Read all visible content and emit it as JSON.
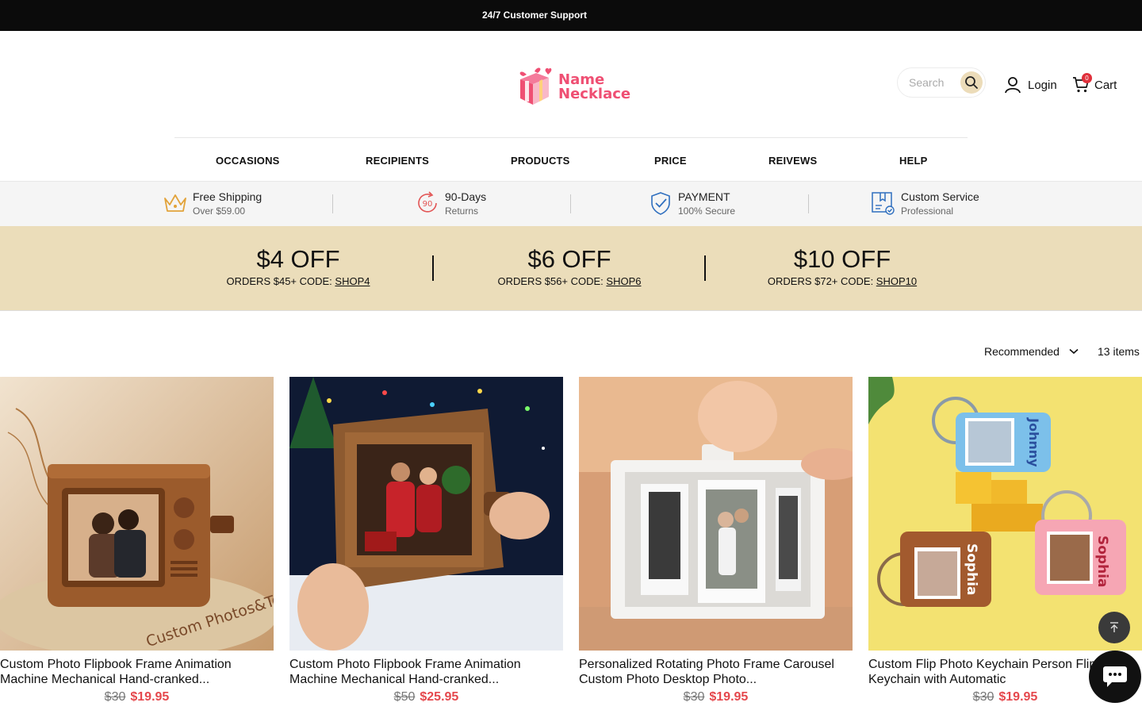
{
  "announcement": "24/7 Customer Support",
  "logo": {
    "line1": "Name",
    "line2": "Necklace",
    "brand_color": "#ef4f73"
  },
  "search": {
    "placeholder": "Search",
    "icon": "search-icon"
  },
  "header": {
    "login_label": "Login",
    "cart_label": "Cart",
    "cart_count": "0"
  },
  "nav": [
    "OCCASIONS",
    "RECIPIENTS",
    "PRODUCTS",
    "PRICE",
    "REIVEWS",
    "HELP"
  ],
  "features": [
    {
      "title": "Free Shipping",
      "subtitle": "Over $59.00",
      "icon": "crown-icon"
    },
    {
      "title": "90-Days",
      "subtitle": "Returns",
      "icon": "returns-90-icon"
    },
    {
      "title": "PAYMENT",
      "subtitle": "100% Secure",
      "icon": "shield-check-icon"
    },
    {
      "title": "Custom Service",
      "subtitle": "Professional",
      "icon": "custom-service-icon"
    }
  ],
  "coupons": [
    {
      "headline": "$4 OFF",
      "condition": "ORDERS $45+  CODE: ",
      "code": "SHOP4"
    },
    {
      "headline": "$6 OFF",
      "condition": "ORDERS $56+  CODE: ",
      "code": "SHOP6"
    },
    {
      "headline": "$10 OFF",
      "condition": "ORDERS $72+  CODE: ",
      "code": "SHOP10"
    }
  ],
  "listing": {
    "sort_label": "Recommended",
    "items_count": "13 items"
  },
  "products": [
    {
      "name": "Custom Photo Flipbook Frame Animation Machine Mechanical Hand-cranked...",
      "old_price": "$30",
      "price": "$19.95",
      "image_caption": "Custom Photos&Text"
    },
    {
      "name": "Custom Photo Flipbook Frame Animation Machine Mechanical Hand-cranked...",
      "old_price": "$50",
      "price": "$25.95"
    },
    {
      "name": "Personalized Rotating Photo Frame Carousel Custom Photo Desktop Photo...",
      "old_price": "$30",
      "price": "$19.95"
    },
    {
      "name": "Custom Flip Photo Keychain Person Flip Photo Keychain with Automatic",
      "old_price": "$30",
      "price": "$19.95",
      "keychain_names": [
        "Johnny",
        "Sophia",
        "Sophia"
      ]
    }
  ],
  "colors": {
    "promo_bg": "#ebddba",
    "price_red": "#e5484d",
    "topbar_bg": "#0b0b0b"
  }
}
